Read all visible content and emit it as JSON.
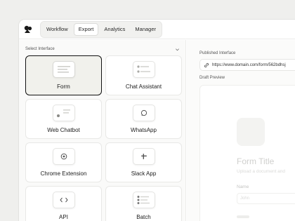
{
  "topbar": {
    "tabs": [
      {
        "label": "Workflow",
        "active": false
      },
      {
        "label": "Export",
        "active": true
      },
      {
        "label": "Analytics",
        "active": false
      },
      {
        "label": "Manager",
        "active": false
      }
    ]
  },
  "left": {
    "select_label": "Select Interface",
    "cards": [
      {
        "label": "Form",
        "icon": "form-icon",
        "selected": true
      },
      {
        "label": "Chat Assistant",
        "icon": "chat-assistant-icon",
        "selected": false
      },
      {
        "label": "Web Chatbot",
        "icon": "web-chatbot-icon",
        "selected": false
      },
      {
        "label": "WhatsApp",
        "icon": "whatsapp-icon",
        "selected": false
      },
      {
        "label": "Chrome Extension",
        "icon": "chrome-extension-icon",
        "selected": false
      },
      {
        "label": "Slack App",
        "icon": "slack-icon",
        "selected": false
      },
      {
        "label": "API",
        "icon": "code-icon",
        "selected": false
      },
      {
        "label": "Batch",
        "icon": "batch-icon",
        "selected": false
      }
    ]
  },
  "right": {
    "published_label": "Published Interface",
    "published_url": "https://www.domain.com/form/562bdhsj",
    "draft_label": "Draft Preview",
    "preview": {
      "title": "Form Title",
      "subtitle": "Upload a document and",
      "field_label": "Name",
      "field_placeholder": "John"
    }
  },
  "colors": {
    "accent": "#111111",
    "background": "#efefed"
  }
}
